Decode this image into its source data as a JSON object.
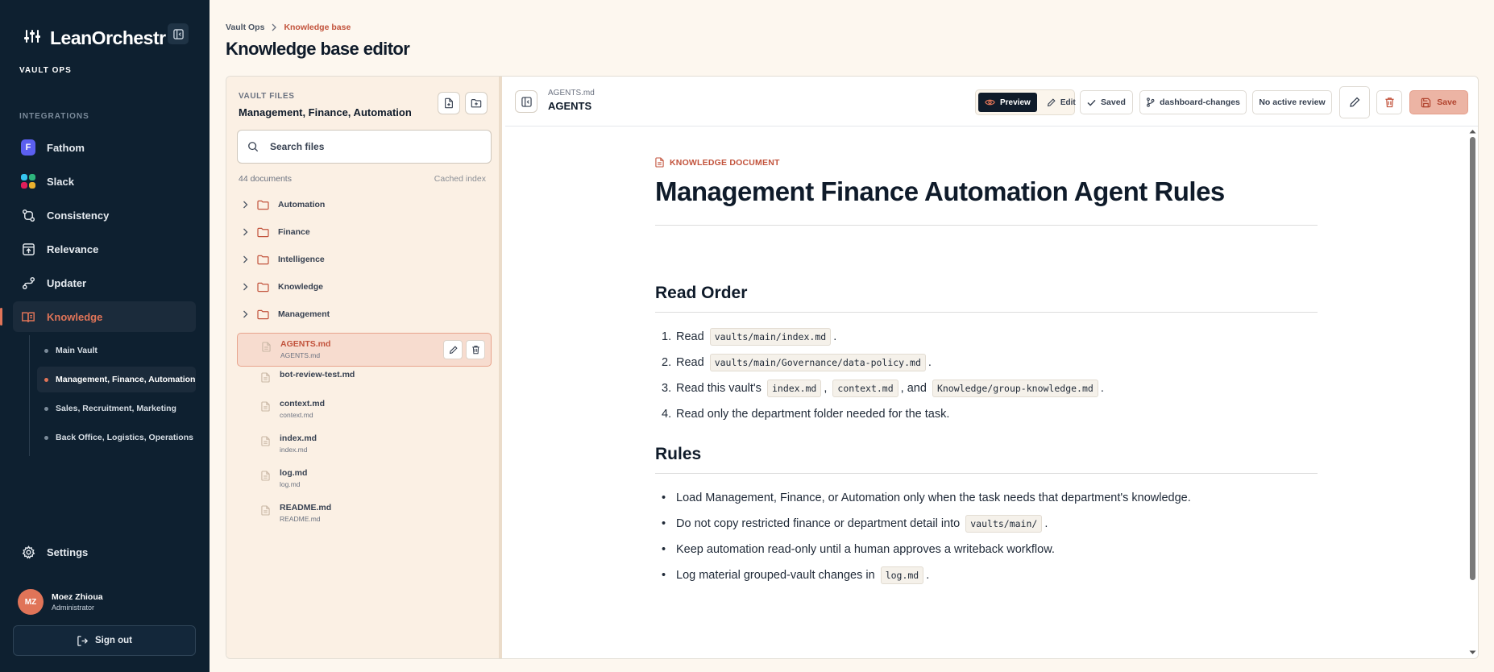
{
  "sidebar": {
    "brand": "LeanOrchestr",
    "workspace": "VAULT OPS",
    "section_label": "INTEGRATIONS",
    "nav": [
      {
        "label": "Fathom",
        "icon": "fathom-icon"
      },
      {
        "label": "Slack",
        "icon": "slack-icon"
      },
      {
        "label": "Consistency",
        "icon": "consistency-icon"
      },
      {
        "label": "Relevance",
        "icon": "relevance-icon"
      },
      {
        "label": "Updater",
        "icon": "updater-icon"
      },
      {
        "label": "Knowledge",
        "icon": "book-icon",
        "active": true
      }
    ],
    "sub_items": [
      {
        "label": "Main Vault"
      },
      {
        "label": "Management, Finance, Automation",
        "active": true
      },
      {
        "label": "Sales, Recruitment, Marketing"
      },
      {
        "label": "Back Office, Logistics, Operations"
      }
    ],
    "settings_label": "Settings",
    "user": {
      "initials": "MZ",
      "name": "Moez Zhioua",
      "role": "Administrator"
    },
    "signout_label": "Sign out"
  },
  "header": {
    "breadcrumb": [
      "Vault Ops",
      "Knowledge base"
    ],
    "title": "Knowledge base editor"
  },
  "files": {
    "label": "VAULT FILES",
    "title": "Management, Finance, Automation",
    "search_placeholder": "Search files",
    "doc_count": "44 documents",
    "cache_status": "Cached index",
    "folders": [
      "Automation",
      "Finance",
      "Intelligence",
      "Knowledge",
      "Management"
    ],
    "items": [
      {
        "name": "AGENTS.md",
        "sub": "AGENTS.md",
        "selected": true
      },
      {
        "name": "bot-review-test.md",
        "sub": ""
      },
      {
        "name": "context.md",
        "sub": "context.md"
      },
      {
        "name": "index.md",
        "sub": "index.md"
      },
      {
        "name": "log.md",
        "sub": "log.md"
      },
      {
        "name": "README.md",
        "sub": "README.md"
      }
    ]
  },
  "editor": {
    "file": "AGENTS.md",
    "name": "AGENTS",
    "preview_label": "Preview",
    "edit_label": "Edit",
    "saved_label": "Saved",
    "branch_label": "dashboard-changes",
    "review_label": "No active review",
    "save_label": "Save"
  },
  "document": {
    "kicker": "KNOWLEDGE DOCUMENT",
    "title": "Management Finance Automation Agent Rules",
    "read_order_heading": "Read Order",
    "read_order": [
      [
        "Read ",
        {
          "code": "vaults/main/index.md"
        },
        "."
      ],
      [
        "Read ",
        {
          "code": "vaults/main/Governance/data-policy.md"
        },
        "."
      ],
      [
        "Read this vault's ",
        {
          "code": "index.md"
        },
        ", ",
        {
          "code": "context.md"
        },
        ", and ",
        {
          "code": "Knowledge/group-knowledge.md"
        },
        "."
      ],
      [
        "Read only the department folder needed for the task."
      ]
    ],
    "rules_heading": "Rules",
    "rules": [
      [
        "Load Management, Finance, or Automation only when the task needs that department's knowledge."
      ],
      [
        "Do not copy restricted finance or department detail into ",
        {
          "code": "vaults/main/"
        },
        "."
      ],
      [
        "Keep automation read-only until a human approves a writeback workflow."
      ],
      [
        "Log material grouped-vault changes in ",
        {
          "code": "log.md"
        },
        "."
      ]
    ]
  },
  "colors": {
    "sidebar_bg": "#0e2030",
    "accent": "#e07458",
    "page_bg": "#fdf7ef",
    "files_bg": "#fbf0e4"
  }
}
